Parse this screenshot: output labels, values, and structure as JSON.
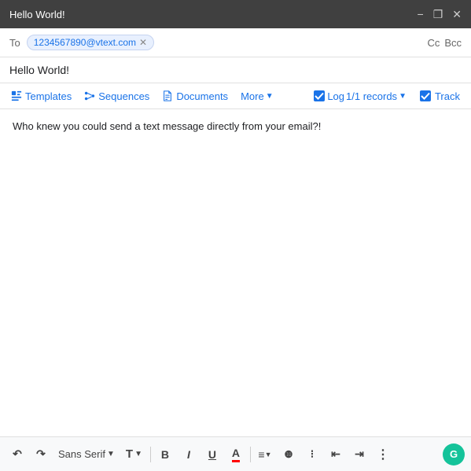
{
  "titleBar": {
    "title": "Hello World!",
    "minimizeIcon": "minimize-icon",
    "expandIcon": "expand-icon",
    "closeIcon": "close-icon"
  },
  "toRow": {
    "label": "To",
    "recipient": "1234567890@vtext.com",
    "cc": "Cc",
    "bcc": "Bcc"
  },
  "subject": "Hello World!",
  "toolbar": {
    "templatesLabel": "Templates",
    "sequencesLabel": "Sequences",
    "documentsLabel": "Documents",
    "moreLabel": "More",
    "logLabel": "Log",
    "logRecords": "1/1 records",
    "trackLabel": "Track"
  },
  "body": {
    "text": "Who knew you could send a text message directly from your email?!"
  },
  "bottomToolbar": {
    "undoLabel": "↺",
    "redoLabel": "↻",
    "fontFamily": "Sans Serif",
    "fontSize": "T",
    "boldLabel": "B",
    "italicLabel": "I",
    "underlineLabel": "U",
    "fontColorLabel": "A",
    "alignLabel": "≡",
    "numberedListLabel": "ol",
    "bulletListLabel": "ul",
    "indentDecreaseLabel": "←",
    "indentIncreaseLabel": "→",
    "moreFormattingLabel": "⋮",
    "grammarlyLabel": "G"
  }
}
